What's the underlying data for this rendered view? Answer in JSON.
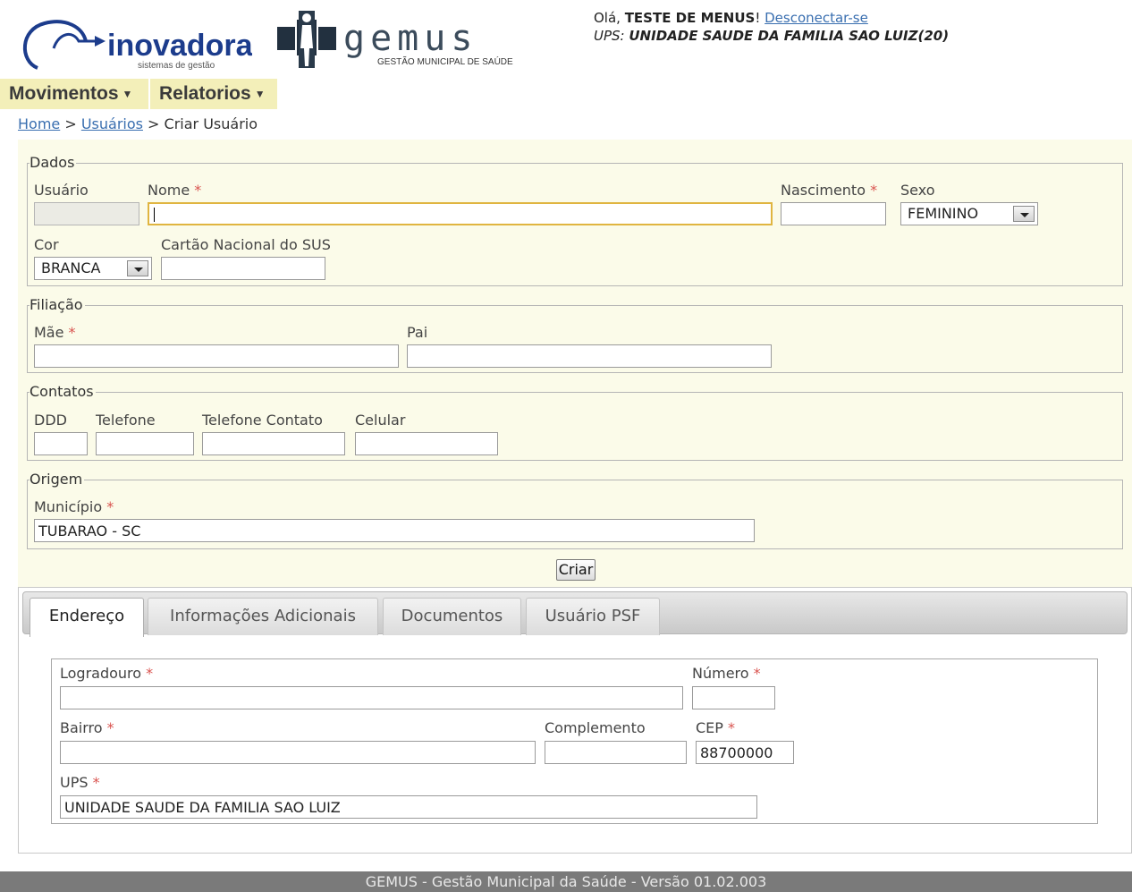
{
  "header": {
    "inovadora_brand": "inovadora",
    "inovadora_tagline": "sistemas de gestão",
    "gemus_brand": "gemus",
    "gemus_tagline": "GESTÃO MUNICIPAL DE SAÚDE",
    "greeting": "Olá, ",
    "user_name": "TESTE DE MENUS",
    "exclaim": "! ",
    "logout_link": "Desconectar-se",
    "ups_label": "UPS: ",
    "ups_value": "UNIDADE SAUDE DA FAMILIA SAO LUIZ(20)"
  },
  "menu": [
    {
      "label": "Movimentos"
    },
    {
      "label": "Relatorios"
    }
  ],
  "breadcrumb": {
    "home": "Home",
    "sep1": " > ",
    "usuarios": "Usuários",
    "sep2": " > ",
    "current": "Criar Usuário"
  },
  "form": {
    "dados": {
      "legend": "Dados",
      "usuario_label": "Usuário",
      "usuario_value": "",
      "nome_label": "Nome",
      "nome_value": "",
      "nascimento_label": "Nascimento",
      "nascimento_value": "",
      "sexo_label": "Sexo",
      "sexo_value": "FEMININO",
      "cor_label": "Cor",
      "cor_value": "BRANCA",
      "cartao_label": "Cartão Nacional do SUS",
      "cartao_value": ""
    },
    "filiacao": {
      "legend": "Filiação",
      "mae_label": "Mãe",
      "mae_value": "",
      "pai_label": "Pai",
      "pai_value": ""
    },
    "contatos": {
      "legend": "Contatos",
      "ddd_label": "DDD",
      "telefone_label": "Telefone",
      "telefone_contato_label": "Telefone Contato",
      "celular_label": "Celular"
    },
    "origem": {
      "legend": "Origem",
      "municipio_label": "Município",
      "municipio_value": "TUBARAO - SC"
    },
    "required_mark": "*",
    "submit_label": "Criar"
  },
  "tabs": [
    {
      "label": "Endereço",
      "active": true
    },
    {
      "label": "Informações Adicionais",
      "active": false
    },
    {
      "label": "Documentos",
      "active": false
    },
    {
      "label": "Usuário PSF",
      "active": false
    }
  ],
  "endereco": {
    "logradouro_label": "Logradouro",
    "logradouro_value": "",
    "numero_label": "Número",
    "numero_value": "",
    "bairro_label": "Bairro",
    "bairro_value": "",
    "complemento_label": "Complemento",
    "complemento_value": "",
    "cep_label": "CEP",
    "cep_value": "88700000",
    "ups_label": "UPS",
    "ups_value": "UNIDADE SAUDE DA FAMILIA SAO LUIZ"
  },
  "footer": {
    "text": "GEMUS - Gestão Municipal da Saúde  - Versão 01.02.003"
  },
  "colors": {
    "menu_bg": "#f3efb9",
    "panel_bg": "#fbfbe9",
    "required": "#d9534f",
    "link": "#3a6fb0",
    "footer_bg": "#7a7a7a",
    "logo_blue": "#1c3c8c"
  }
}
